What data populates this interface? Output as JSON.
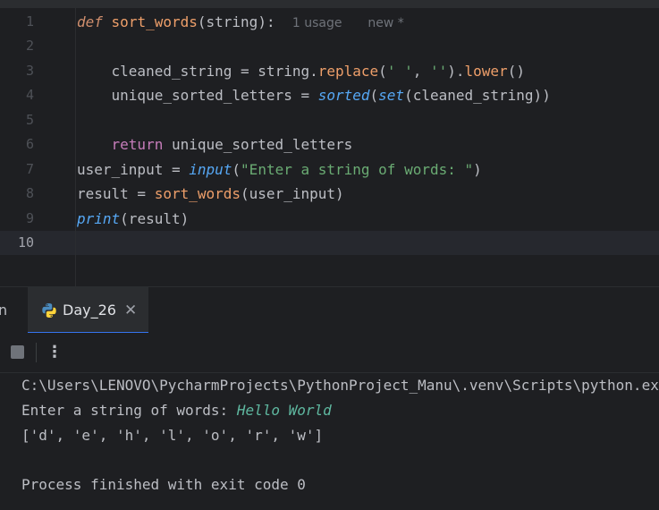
{
  "editor": {
    "line_numbers": [
      "1",
      "2",
      "3",
      "4",
      "5",
      "6",
      "7",
      "8",
      "9",
      "10"
    ],
    "inlay_hints": {
      "usages": "1 usage",
      "new": "new *"
    },
    "lines": [
      [
        "def",
        " ",
        "sort_words",
        "(",
        "string",
        "):"
      ],
      [],
      [
        "    cleaned_string = ",
        "string",
        ".",
        "replace",
        "(",
        "' '",
        ", ",
        "''",
        ").",
        "lower",
        "()"
      ],
      [
        "    unique_sorted_letters = ",
        "sorted",
        "(",
        "set",
        "(cleaned_string))"
      ],
      [],
      [
        "    ",
        "return",
        " unique_sorted_letters"
      ],
      [
        "user_input = ",
        "input",
        "(",
        "\"Enter a string of words: \"",
        ")"
      ],
      [
        "result = ",
        "sort_words",
        "(user_input)"
      ],
      [
        "print",
        "(result)"
      ],
      []
    ]
  },
  "tool_window": {
    "partial_tab_label": "n",
    "active_tab_label": "Day_26",
    "close_glyph": "✕",
    "more_glyph": "⋮"
  },
  "console": {
    "path_line": "C:\\Users\\LENOVO\\PycharmProjects\\PythonProject_Manu\\.venv\\Scripts\\python.exe",
    "prompt": "Enter a string of words: ",
    "user_input": "Hello World",
    "output": "['d', 'e', 'h', 'l', 'o', 'r', 'w']",
    "finished": "Process finished with exit code 0"
  },
  "colors": {
    "background": "#1e1f22",
    "keyword": "#cf8e6d",
    "function": "#56a8f5",
    "builtin": "#8888c6",
    "string": "#6aab73",
    "accent": "#3574f0"
  }
}
